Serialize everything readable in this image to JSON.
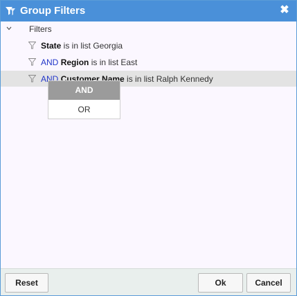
{
  "dialog": {
    "title": "Group Filters",
    "title_icon": "filter-group-icon",
    "close_icon": "close-icon",
    "close_glyph": "✖",
    "accent": "#4a90d9"
  },
  "tree": {
    "root_label": "Filters",
    "rows": [
      {
        "operator": "",
        "field": "State",
        "rest": " is in list Georgia"
      },
      {
        "operator": "AND",
        "field": "Region",
        "rest": " is in list East"
      },
      {
        "operator": "AND",
        "field": "Customer Name",
        "rest": " is in list Ralph Kennedy"
      }
    ]
  },
  "operator_menu": {
    "options": [
      "AND",
      "OR"
    ],
    "selected": "AND"
  },
  "footer": {
    "reset_label": "Reset",
    "ok_label": "Ok",
    "cancel_label": "Cancel"
  }
}
